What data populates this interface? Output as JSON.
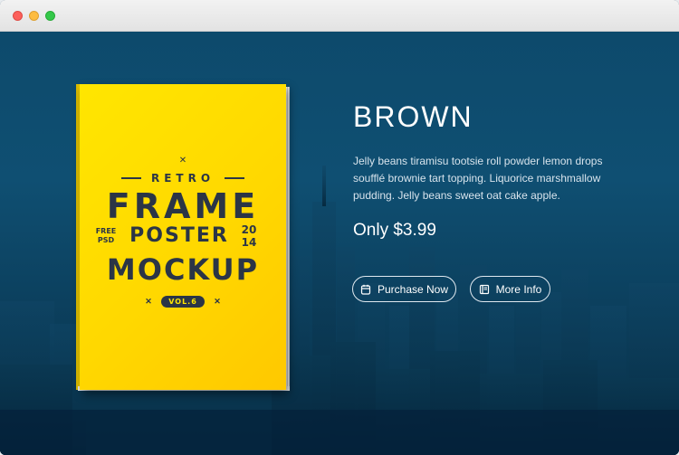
{
  "window": {
    "controls": [
      "close",
      "minimize",
      "maximize"
    ]
  },
  "cover": {
    "retro": "RETRO",
    "frame": "FRAME",
    "free_psd": [
      "FREE",
      "PSD"
    ],
    "poster": "POSTER",
    "year": [
      "20",
      "14"
    ],
    "mockup": "MOCKUP",
    "vol": "VOL.6"
  },
  "product": {
    "title": "BROWN",
    "description": "Jelly beans tiramisu tootsie roll powder lemon drops soufflé brownie tart topping. Liquorice marshmallow pudding. Jelly beans sweet oat cake apple.",
    "price": "Only $3.99"
  },
  "buttons": {
    "purchase_label": "Purchase Now",
    "purchase_icon": "basket-icon",
    "more_label": "More Info",
    "more_icon": "book-icon"
  },
  "colors": {
    "background": "#0d4a6c",
    "cover": "#ffe600",
    "cover_text": "#2b3546"
  }
}
